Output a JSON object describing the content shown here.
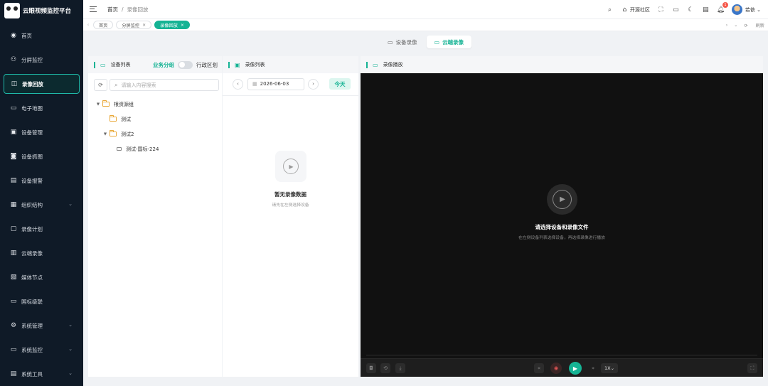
{
  "app": {
    "title": "云眼视频监控平台"
  },
  "sidebar": {
    "items": [
      {
        "label": "首页",
        "icon": "dashboard-icon",
        "glyph": "◉",
        "active": false,
        "has_children": false
      },
      {
        "label": "分屏监控",
        "icon": "split-screen-icon",
        "glyph": "⚇",
        "active": false,
        "has_children": false
      },
      {
        "label": "录像回放",
        "icon": "playback-icon",
        "glyph": "◫",
        "active": true,
        "has_children": false
      },
      {
        "label": "电子地图",
        "icon": "map-icon",
        "glyph": "▭",
        "active": false,
        "has_children": false
      },
      {
        "label": "设备管理",
        "icon": "device-icon",
        "glyph": "▣",
        "active": false,
        "has_children": false
      },
      {
        "label": "设备抓图",
        "icon": "snapshot-icon",
        "glyph": "◙",
        "active": false,
        "has_children": false
      },
      {
        "label": "设备报警",
        "icon": "alarm-icon",
        "glyph": "▤",
        "active": false,
        "has_children": false
      },
      {
        "label": "组织结构",
        "icon": "org-icon",
        "glyph": "▦",
        "active": false,
        "has_children": true
      },
      {
        "label": "录像计划",
        "icon": "plan-icon",
        "glyph": "▢",
        "active": false,
        "has_children": false
      },
      {
        "label": "云端录像",
        "icon": "cloud-record-icon",
        "glyph": "▥",
        "active": false,
        "has_children": false
      },
      {
        "label": "媒体节点",
        "icon": "media-node-icon",
        "glyph": "▧",
        "active": false,
        "has_children": false
      },
      {
        "label": "国标级联",
        "icon": "cascade-icon",
        "glyph": "▭",
        "active": false,
        "has_children": false
      },
      {
        "label": "系统管理",
        "icon": "gear-icon",
        "glyph": "⚙",
        "active": false,
        "has_children": true
      },
      {
        "label": "系统监控",
        "icon": "monitor-icon",
        "glyph": "▭",
        "active": false,
        "has_children": true
      },
      {
        "label": "系统工具",
        "icon": "toolbox-icon",
        "glyph": "▤",
        "active": false,
        "has_children": true
      }
    ]
  },
  "header": {
    "breadcrumb": [
      "首页",
      "录像回放"
    ],
    "breadcrumb_sep": "/",
    "community_label": "开源社区",
    "notification_count": "1",
    "user_name": "若依"
  },
  "tabs": {
    "items": [
      {
        "label": "首页",
        "closable": false,
        "active": false
      },
      {
        "label": "分屏监控",
        "closable": true,
        "active": false
      },
      {
        "label": "录像回放",
        "closable": true,
        "active": true
      }
    ],
    "refresh_label": "刷新"
  },
  "mode_switch": {
    "device_label": "设备录像",
    "cloud_label": "云端录像",
    "active": "cloud"
  },
  "device_panel": {
    "title": "设备列表",
    "switch_on_label": "业务分组",
    "switch_off_label": "行政区划",
    "search_placeholder": "请输入内容搜索",
    "tree": [
      {
        "label": "根资源组",
        "level": 0,
        "type": "folder",
        "expanded": true,
        "has_caret": true
      },
      {
        "label": "测试",
        "level": 1,
        "type": "folder",
        "expanded": false,
        "has_caret": false
      },
      {
        "label": "测试2",
        "level": 1,
        "type": "folder",
        "expanded": true,
        "has_caret": true
      },
      {
        "label": "测试-国标-224",
        "level": 2,
        "type": "camera",
        "expanded": false,
        "has_caret": false
      }
    ]
  },
  "record_panel": {
    "title": "录像列表",
    "date": "2026-06-03",
    "today_label": "今天",
    "empty_title": "暂无录像数据",
    "empty_sub": "请先在左侧选择设备"
  },
  "player_panel": {
    "title": "录像播放",
    "placeholder_title": "请选择设备和录像文件",
    "placeholder_sub": "在左侧设备列表选择设备，再选择录像进行播放",
    "speed": "1X"
  },
  "colors": {
    "accent": "#15b394",
    "sidebar_bg": "#0f1a27",
    "player_bg": "#111111"
  }
}
